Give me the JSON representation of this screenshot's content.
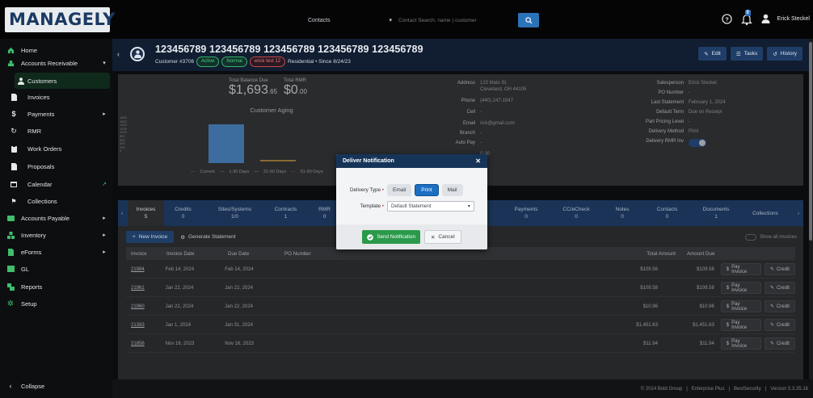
{
  "app": {
    "logo": "MANAGELY"
  },
  "topbar": {
    "search_scope": "Contacts",
    "search_placeholder": "Contact Search: name | customer",
    "notification_count": "0",
    "user_name": "Erick Steckel"
  },
  "sidebar": {
    "items": [
      {
        "label": "Home",
        "icon": "home-icon"
      },
      {
        "label": "Accounts Receivable",
        "icon": "receivable-icon",
        "expandable": true
      },
      {
        "label": "Customers",
        "icon": "person-icon"
      },
      {
        "label": "Invoices",
        "icon": "document-icon"
      },
      {
        "label": "Payments",
        "icon": "dollar-icon",
        "expandable": true
      },
      {
        "label": "RMR",
        "icon": "refresh-icon"
      },
      {
        "label": "Work Orders",
        "icon": "clipboard-icon"
      },
      {
        "label": "Proposals",
        "icon": "document-icon"
      },
      {
        "label": "Calendar",
        "icon": "calendar-icon"
      },
      {
        "label": "Collections",
        "icon": "collections-icon"
      },
      {
        "label": "Accounts Payable",
        "icon": "payable-icon",
        "expandable": true
      },
      {
        "label": "Inventory",
        "icon": "boxes-icon",
        "expandable": true
      },
      {
        "label": "eForms",
        "icon": "form-icon",
        "expandable": true
      },
      {
        "label": "GL",
        "icon": "ledger-icon"
      },
      {
        "label": "Reports",
        "icon": "chart-icon"
      },
      {
        "label": "Setup",
        "icon": "gear-icon"
      }
    ],
    "collapse_label": "Collapse"
  },
  "customer": {
    "name": "123456789 123456789 123456789 123456789 123456789",
    "number": "Customer #3706",
    "status_active": "Active",
    "status_normal": "Normal",
    "status_tag": "erick test 12",
    "meta": "Residential • Since 8/24/23"
  },
  "header_buttons": {
    "edit": "Edit",
    "tasks": "Tasks",
    "history": "History"
  },
  "balance": {
    "total_balance_label": "Total Balance Due",
    "total_balance_main": "$1,693",
    "total_balance_cents": ".65",
    "total_rmr_label": "Total RMR",
    "total_rmr_main": "$0",
    "total_rmr_cents": ".00",
    "aging_title": "Customer Aging",
    "y_ticks": [
      "1800",
      "1600",
      "1400",
      "1200",
      "1000",
      "800",
      "600",
      "400",
      "200",
      "0"
    ],
    "legend": [
      "Current",
      "1-30 Days",
      "31-60 Days",
      "61-90 Days"
    ]
  },
  "info": {
    "left": [
      {
        "k": "Address",
        "v": "123 Main St."
      },
      {
        "k": "",
        "v": "Cleveland, OH 44105"
      },
      {
        "k": "Phone",
        "v": "(440) 247-1547"
      },
      {
        "k": "Cell",
        "v": "-"
      },
      {
        "k": "Email",
        "v": "rick@gmail.com"
      },
      {
        "k": "Branch",
        "v": "-"
      },
      {
        "k": "Auto Pay",
        "v": "-"
      },
      {
        "k": "",
        "v": "0-30"
      }
    ],
    "right": [
      {
        "k": "Salesperson",
        "v": "Erick Steckel"
      },
      {
        "k": "PO Number",
        "v": "-"
      },
      {
        "k": "Last Statement",
        "v": "February 1, 2024"
      },
      {
        "k": "Default Term",
        "v": "Due on Receipt"
      },
      {
        "k": "Part Pricing Level",
        "v": "-"
      },
      {
        "k": "Delivery Method",
        "v": "Print"
      },
      {
        "k": "Delivery RMR Inv",
        "v": ""
      }
    ]
  },
  "tabs": [
    {
      "label": "Invoices",
      "count": "5"
    },
    {
      "label": "Credits",
      "count": "0"
    },
    {
      "label": "Sites/Systems",
      "count": "1/0"
    },
    {
      "label": "Contracts",
      "count": "1"
    },
    {
      "label": "RMR",
      "count": "0"
    },
    {
      "label": "Payments",
      "count": "0"
    },
    {
      "label": "CC/eCheck",
      "count": "0"
    },
    {
      "label": "Notes",
      "count": "0"
    },
    {
      "label": "Contacts",
      "count": "0"
    },
    {
      "label": "Documents",
      "count": "1"
    },
    {
      "label": "Collections",
      "count": ""
    }
  ],
  "grid": {
    "new_invoice": "New Invoice",
    "generate_statement": "Generate Statement",
    "show_all": "Show all invoices",
    "columns": [
      "Invoice",
      "Invoice Date",
      "Due Date",
      "PO Number",
      "Total Amount",
      "Amount Due"
    ],
    "pay_label": "Pay Invoice",
    "credit_label": "Credit",
    "rows": [
      {
        "invoice": "21984",
        "date": "Feb 14, 2024",
        "due": "Feb 14, 2024",
        "po": "",
        "total": "$109.56",
        "amount_due": "$109.56"
      },
      {
        "invoice": "21961",
        "date": "Jan 22, 2024",
        "due": "Jan 22, 2024",
        "po": "",
        "total": "$109.58",
        "amount_due": "$109.58"
      },
      {
        "invoice": "21960",
        "date": "Jan 22, 2024",
        "due": "Jan 22, 2024",
        "po": "",
        "total": "$10.96",
        "amount_due": "$10.96"
      },
      {
        "invoice": "21383",
        "date": "Jan 1, 2024",
        "due": "Jan 31, 2024",
        "po": "",
        "total": "$1,451.63",
        "amount_due": "$1,451.63"
      },
      {
        "invoice": "21856",
        "date": "Nov 16, 2023",
        "due": "Nov 16, 2023",
        "po": "",
        "total": "$11.94",
        "amount_due": "$11.94"
      }
    ]
  },
  "footer": {
    "copyright": "© 2024 Bold Group",
    "edition": "Enterprise Plus",
    "security": "BestSecurity",
    "version": "Version 5.3.35.16"
  },
  "modal": {
    "title": "Deliver Notification",
    "delivery_type_label": "Delivery Type",
    "options": [
      "Email",
      "Print",
      "Mail"
    ],
    "selected_option": "Print",
    "template_label": "Template",
    "template_value": "Default Statement",
    "send_label": "Send Notification",
    "cancel_label": "Cancel"
  },
  "colors": {
    "brand_navy": "#163458",
    "accent_blue": "#1d6fc2",
    "success_green": "#2a9a4a",
    "sidebar_active": "#0f2a1b"
  }
}
